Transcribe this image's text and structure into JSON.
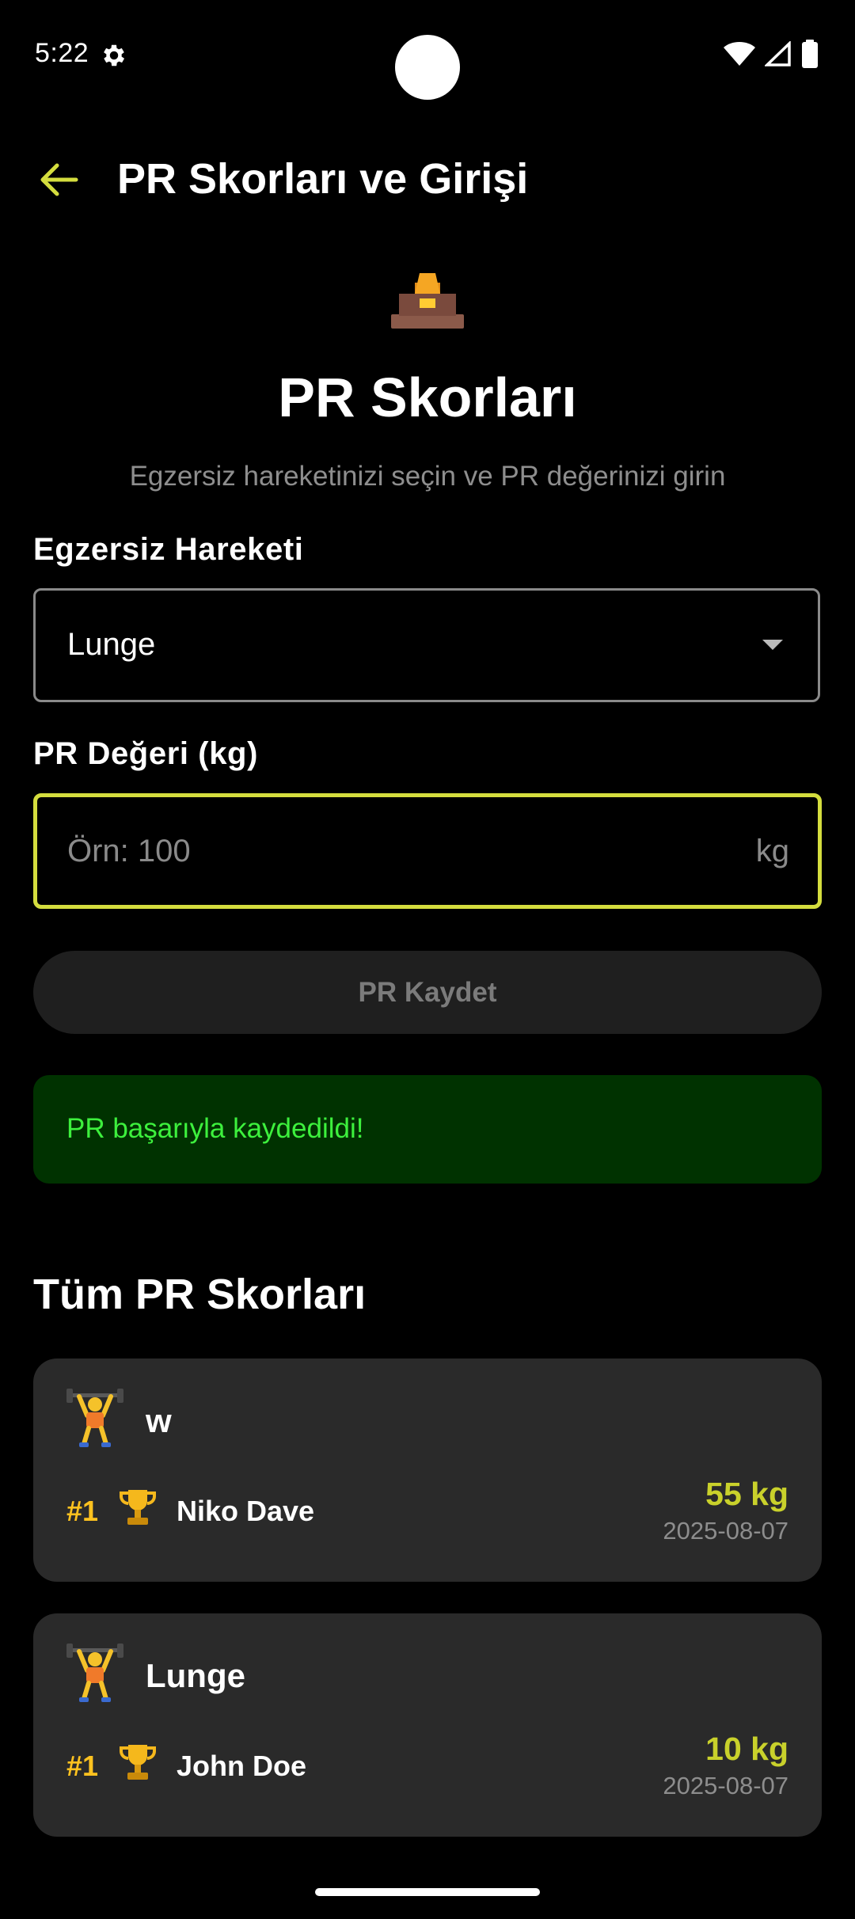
{
  "status_bar": {
    "time": "5:22"
  },
  "app_bar": {
    "title": "PR Skorları ve Girişi"
  },
  "hero": {
    "title": "PR Skorları",
    "subtitle": "Egzersiz hareketinizi seçin ve PR değerinizi girin"
  },
  "exercise_field": {
    "label": "Egzersiz Hareketi",
    "selected": "Lunge"
  },
  "pr_field": {
    "label": "PR Değeri (kg)",
    "value": "",
    "placeholder": "Örn: 100",
    "suffix": "kg"
  },
  "save_button": {
    "label": "PR Kaydet"
  },
  "success_message": "PR başarıyla kaydedildi!",
  "records_section": {
    "title": "Tüm PR Skorları",
    "cards": [
      {
        "exercise": "w",
        "rank": "#1",
        "name": "Niko Dave",
        "value": "55 kg",
        "date": "2025-08-07"
      },
      {
        "exercise": "Lunge",
        "rank": "#1",
        "name": "John Doe",
        "value": "10 kg",
        "date": "2025-08-07"
      }
    ]
  },
  "colors": {
    "accent": "#d4dd3e",
    "value_green": "#c9d12b",
    "rank_gold": "#ffc21f",
    "success_bg": "#003200",
    "success_text": "#3df03d",
    "card_bg": "#2a2a2a"
  },
  "icons": {
    "status_bar": [
      "gear-icon",
      "wifi-icon",
      "signal-icon",
      "battery-icon"
    ],
    "app_bar": "back-arrow-icon",
    "hero": "podium-icon",
    "card_icon": "weightlifter-icon",
    "rank_icon": "trophy-icon"
  }
}
